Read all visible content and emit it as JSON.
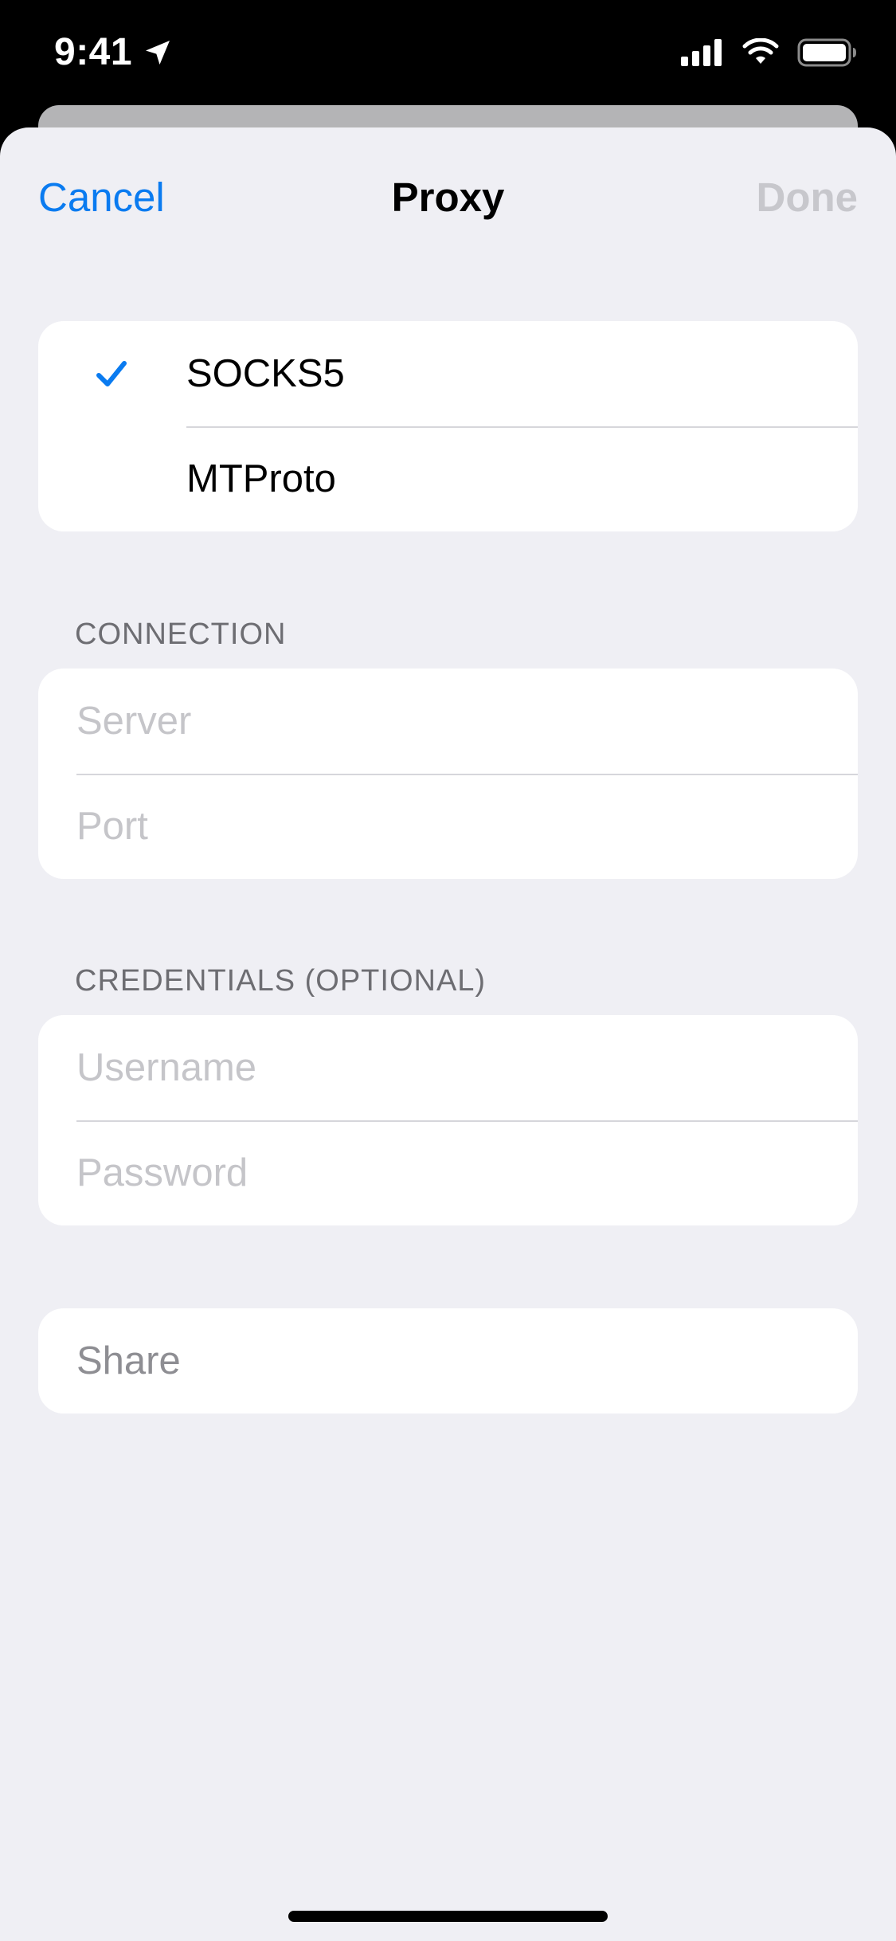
{
  "status_bar": {
    "time": "9:41",
    "icons": [
      "location-arrow-icon",
      "cellular-signal-icon",
      "wifi-icon",
      "battery-icon"
    ]
  },
  "nav": {
    "cancel_label": "Cancel",
    "title": "Proxy",
    "done_label": "Done"
  },
  "proxy_types": {
    "items": [
      {
        "label": "SOCKS5",
        "selected": true
      },
      {
        "label": "MTProto",
        "selected": false
      }
    ]
  },
  "connection": {
    "header": "CONNECTION",
    "server": {
      "value": "",
      "placeholder": "Server"
    },
    "port": {
      "value": "",
      "placeholder": "Port"
    }
  },
  "credentials": {
    "header": "CREDENTIALS (OPTIONAL)",
    "username": {
      "value": "",
      "placeholder": "Username"
    },
    "password": {
      "value": "",
      "placeholder": "Password"
    }
  },
  "share": {
    "label": "Share"
  },
  "colors": {
    "accent": "#0a7bf0",
    "background": "#efeff4",
    "disabled": "#c7c7cc",
    "placeholder": "#c5c5c9"
  }
}
